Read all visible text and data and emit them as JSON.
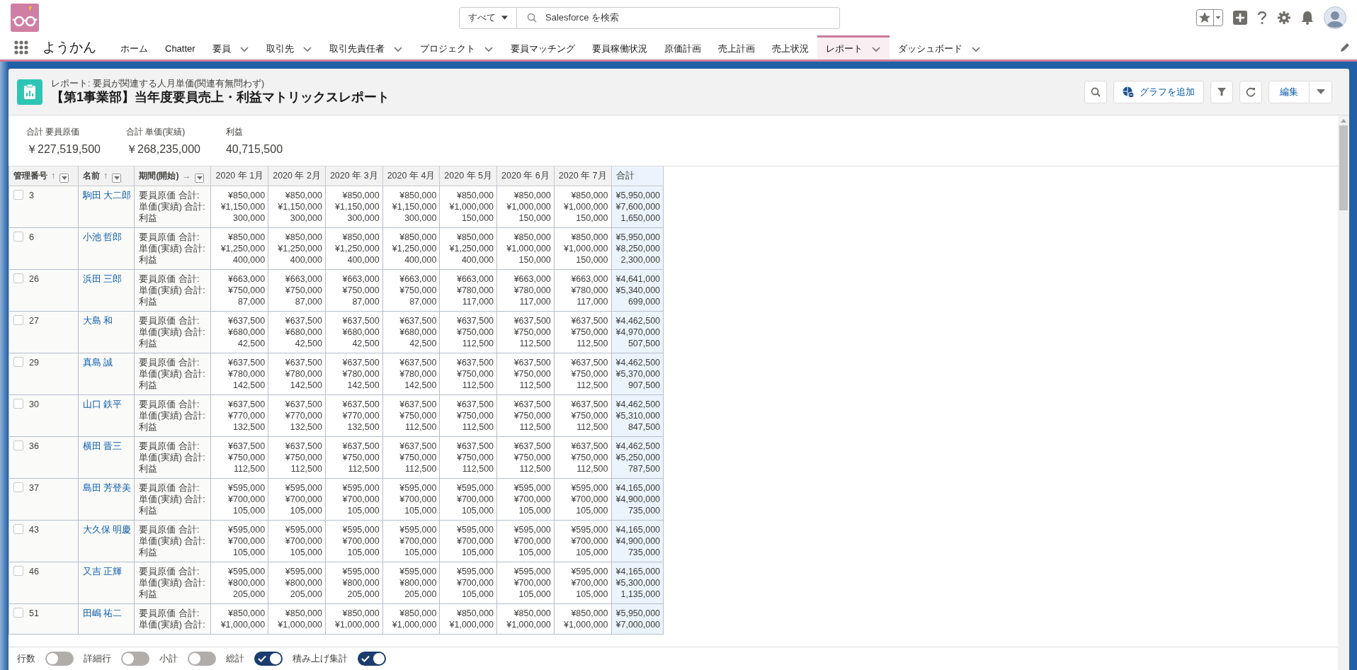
{
  "app": {
    "name": "ようかん"
  },
  "search": {
    "scope": "すべて",
    "placeholder": "Salesforce を検索"
  },
  "nav": [
    {
      "label": "ホーム",
      "dropdown": false,
      "selected": false
    },
    {
      "label": "Chatter",
      "dropdown": false,
      "selected": false
    },
    {
      "label": "要員",
      "dropdown": true,
      "selected": false
    },
    {
      "label": "取引先",
      "dropdown": true,
      "selected": false
    },
    {
      "label": "取引先責任者",
      "dropdown": true,
      "selected": false
    },
    {
      "label": "プロジェクト",
      "dropdown": true,
      "selected": false
    },
    {
      "label": "要員マッチング",
      "dropdown": false,
      "selected": false
    },
    {
      "label": "要員稼働状況",
      "dropdown": false,
      "selected": false
    },
    {
      "label": "原価計画",
      "dropdown": false,
      "selected": false
    },
    {
      "label": "売上計画",
      "dropdown": false,
      "selected": false
    },
    {
      "label": "売上状況",
      "dropdown": false,
      "selected": false
    },
    {
      "label": "レポート",
      "dropdown": true,
      "selected": true
    },
    {
      "label": "ダッシュボード",
      "dropdown": true,
      "selected": false
    }
  ],
  "report": {
    "type_label": "レポート: 要員が関連する人月単価(関連有無問わず)",
    "title": "【第1事業部】当年度要員売上・利益マトリックスレポート",
    "add_chart": "グラフを追加",
    "edit": "編集"
  },
  "summary": [
    {
      "label": "合計 要員原価",
      "value": "￥227,519,500"
    },
    {
      "label": "合計 単価(実績)",
      "value": "￥268,235,000"
    },
    {
      "label": "利益",
      "value": "40,715,500"
    }
  ],
  "table": {
    "row_header_columns": [
      {
        "label": "管理番号",
        "sort_icon": "↑",
        "menu": true
      },
      {
        "label": "名前",
        "sort_icon": "↑",
        "menu": true
      },
      {
        "label": "期間(開始)",
        "sort_icon": "→",
        "menu": true
      }
    ],
    "columns": [
      {
        "label": "2020 年 1月"
      },
      {
        "label": "2020 年 2月"
      },
      {
        "label": "2020 年 3月"
      },
      {
        "label": "2020 年 4月"
      },
      {
        "label": "2020 年 5月"
      },
      {
        "label": "2020 年 6月"
      },
      {
        "label": "2020 年 7月"
      },
      {
        "label": "合計",
        "total": true
      }
    ],
    "rows": [
      {
        "id": "3",
        "name": "駒田 大二郎",
        "checked": false,
        "labels": [
          "要員原価 合計:",
          "単価(実績) 合計:",
          "利益"
        ],
        "cells": [
          [
            "¥850,000",
            "¥1,150,000",
            "300,000"
          ],
          [
            "¥850,000",
            "¥1,150,000",
            "300,000"
          ],
          [
            "¥850,000",
            "¥1,150,000",
            "300,000"
          ],
          [
            "¥850,000",
            "¥1,150,000",
            "300,000"
          ],
          [
            "¥850,000",
            "¥1,000,000",
            "150,000"
          ],
          [
            "¥850,000",
            "¥1,000,000",
            "150,000"
          ],
          [
            "¥850,000",
            "¥1,000,000",
            "150,000"
          ],
          [
            "¥5,950,000",
            "¥7,600,000",
            "1,650,000"
          ]
        ]
      },
      {
        "id": "6",
        "name": "小池 哲郎",
        "checked": false,
        "labels": [
          "要員原価 合計:",
          "単価(実績) 合計:",
          "利益"
        ],
        "cells": [
          [
            "¥850,000",
            "¥1,250,000",
            "400,000"
          ],
          [
            "¥850,000",
            "¥1,250,000",
            "400,000"
          ],
          [
            "¥850,000",
            "¥1,250,000",
            "400,000"
          ],
          [
            "¥850,000",
            "¥1,250,000",
            "400,000"
          ],
          [
            "¥850,000",
            "¥1,250,000",
            "400,000"
          ],
          [
            "¥850,000",
            "¥1,000,000",
            "150,000"
          ],
          [
            "¥850,000",
            "¥1,000,000",
            "150,000"
          ],
          [
            "¥5,950,000",
            "¥8,250,000",
            "2,300,000"
          ]
        ]
      },
      {
        "id": "26",
        "name": "浜田 三郎",
        "checked": false,
        "labels": [
          "要員原価 合計:",
          "単価(実績) 合計:",
          "利益"
        ],
        "cells": [
          [
            "¥663,000",
            "¥750,000",
            "87,000"
          ],
          [
            "¥663,000",
            "¥750,000",
            "87,000"
          ],
          [
            "¥663,000",
            "¥750,000",
            "87,000"
          ],
          [
            "¥663,000",
            "¥750,000",
            "87,000"
          ],
          [
            "¥663,000",
            "¥780,000",
            "117,000"
          ],
          [
            "¥663,000",
            "¥780,000",
            "117,000"
          ],
          [
            "¥663,000",
            "¥780,000",
            "117,000"
          ],
          [
            "¥4,641,000",
            "¥5,340,000",
            "699,000"
          ]
        ]
      },
      {
        "id": "27",
        "name": "大島 和",
        "checked": false,
        "labels": [
          "要員原価 合計:",
          "単価(実績) 合計:",
          "利益"
        ],
        "cells": [
          [
            "¥637,500",
            "¥680,000",
            "42,500"
          ],
          [
            "¥637,500",
            "¥680,000",
            "42,500"
          ],
          [
            "¥637,500",
            "¥680,000",
            "42,500"
          ],
          [
            "¥637,500",
            "¥680,000",
            "42,500"
          ],
          [
            "¥637,500",
            "¥750,000",
            "112,500"
          ],
          [
            "¥637,500",
            "¥750,000",
            "112,500"
          ],
          [
            "¥637,500",
            "¥750,000",
            "112,500"
          ],
          [
            "¥4,462,500",
            "¥4,970,000",
            "507,500"
          ]
        ]
      },
      {
        "id": "29",
        "name": "真島 誠",
        "checked": false,
        "labels": [
          "要員原価 合計:",
          "単価(実績) 合計:",
          "利益"
        ],
        "cells": [
          [
            "¥637,500",
            "¥780,000",
            "142,500"
          ],
          [
            "¥637,500",
            "¥780,000",
            "142,500"
          ],
          [
            "¥637,500",
            "¥780,000",
            "142,500"
          ],
          [
            "¥637,500",
            "¥780,000",
            "142,500"
          ],
          [
            "¥637,500",
            "¥750,000",
            "112,500"
          ],
          [
            "¥637,500",
            "¥750,000",
            "112,500"
          ],
          [
            "¥637,500",
            "¥750,000",
            "112,500"
          ],
          [
            "¥4,462,500",
            "¥5,370,000",
            "907,500"
          ]
        ]
      },
      {
        "id": "30",
        "name": "山口 鉄平",
        "checked": false,
        "labels": [
          "要員原価 合計:",
          "単価(実績) 合計:",
          "利益"
        ],
        "cells": [
          [
            "¥637,500",
            "¥770,000",
            "132,500"
          ],
          [
            "¥637,500",
            "¥770,000",
            "132,500"
          ],
          [
            "¥637,500",
            "¥770,000",
            "132,500"
          ],
          [
            "¥637,500",
            "¥750,000",
            "112,500"
          ],
          [
            "¥637,500",
            "¥750,000",
            "112,500"
          ],
          [
            "¥637,500",
            "¥750,000",
            "112,500"
          ],
          [
            "¥637,500",
            "¥750,000",
            "112,500"
          ],
          [
            "¥4,462,500",
            "¥5,310,000",
            "847,500"
          ]
        ]
      },
      {
        "id": "36",
        "name": "横田 晋三",
        "checked": false,
        "labels": [
          "要員原価 合計:",
          "単価(実績) 合計:",
          "利益"
        ],
        "cells": [
          [
            "¥637,500",
            "¥750,000",
            "112,500"
          ],
          [
            "¥637,500",
            "¥750,000",
            "112,500"
          ],
          [
            "¥637,500",
            "¥750,000",
            "112,500"
          ],
          [
            "¥637,500",
            "¥750,000",
            "112,500"
          ],
          [
            "¥637,500",
            "¥750,000",
            "112,500"
          ],
          [
            "¥637,500",
            "¥750,000",
            "112,500"
          ],
          [
            "¥637,500",
            "¥750,000",
            "112,500"
          ],
          [
            "¥4,462,500",
            "¥5,250,000",
            "787,500"
          ]
        ]
      },
      {
        "id": "37",
        "name": "島田 芳登美",
        "checked": false,
        "labels": [
          "要員原価 合計:",
          "単価(実績) 合計:",
          "利益"
        ],
        "cells": [
          [
            "¥595,000",
            "¥700,000",
            "105,000"
          ],
          [
            "¥595,000",
            "¥700,000",
            "105,000"
          ],
          [
            "¥595,000",
            "¥700,000",
            "105,000"
          ],
          [
            "¥595,000",
            "¥700,000",
            "105,000"
          ],
          [
            "¥595,000",
            "¥700,000",
            "105,000"
          ],
          [
            "¥595,000",
            "¥700,000",
            "105,000"
          ],
          [
            "¥595,000",
            "¥700,000",
            "105,000"
          ],
          [
            "¥4,165,000",
            "¥4,900,000",
            "735,000"
          ]
        ]
      },
      {
        "id": "43",
        "name": "大久保 明慶",
        "checked": false,
        "labels": [
          "要員原価 合計:",
          "単価(実績) 合計:",
          "利益"
        ],
        "cells": [
          [
            "¥595,000",
            "¥700,000",
            "105,000"
          ],
          [
            "¥595,000",
            "¥700,000",
            "105,000"
          ],
          [
            "¥595,000",
            "¥700,000",
            "105,000"
          ],
          [
            "¥595,000",
            "¥700,000",
            "105,000"
          ],
          [
            "¥595,000",
            "¥700,000",
            "105,000"
          ],
          [
            "¥595,000",
            "¥700,000",
            "105,000"
          ],
          [
            "¥595,000",
            "¥700,000",
            "105,000"
          ],
          [
            "¥4,165,000",
            "¥4,900,000",
            "735,000"
          ]
        ]
      },
      {
        "id": "46",
        "name": "又吉 正輝",
        "checked": false,
        "labels": [
          "要員原価 合計:",
          "単価(実績) 合計:",
          "利益"
        ],
        "cells": [
          [
            "¥595,000",
            "¥800,000",
            "205,000"
          ],
          [
            "¥595,000",
            "¥800,000",
            "205,000"
          ],
          [
            "¥595,000",
            "¥800,000",
            "205,000"
          ],
          [
            "¥595,000",
            "¥800,000",
            "205,000"
          ],
          [
            "¥595,000",
            "¥700,000",
            "105,000"
          ],
          [
            "¥595,000",
            "¥700,000",
            "105,000"
          ],
          [
            "¥595,000",
            "¥700,000",
            "105,000"
          ],
          [
            "¥4,165,000",
            "¥5,300,000",
            "1,135,000"
          ]
        ]
      },
      {
        "id": "51",
        "name": "田嶋 祐二",
        "checked": false,
        "labels": [
          "要員原価 合計:",
          "単価(実績) 合計:"
        ],
        "cells": [
          [
            "¥850,000",
            "¥1,000,000"
          ],
          [
            "¥850,000",
            "¥1,000,000"
          ],
          [
            "¥850,000",
            "¥1,000,000"
          ],
          [
            "¥850,000",
            "¥1,000,000"
          ],
          [
            "¥850,000",
            "¥1,000,000"
          ],
          [
            "¥850,000",
            "¥1,000,000"
          ],
          [
            "¥850,000",
            "¥1,000,000"
          ],
          [
            "¥5,950,000",
            "¥7,000,000"
          ]
        ]
      }
    ]
  },
  "toggles": [
    {
      "label": "行数",
      "on": false
    },
    {
      "label": "詳細行",
      "on": false
    },
    {
      "label": "小計",
      "on": false
    },
    {
      "label": "総計",
      "on": true
    },
    {
      "label": "積み上げ集計",
      "on": true
    }
  ]
}
